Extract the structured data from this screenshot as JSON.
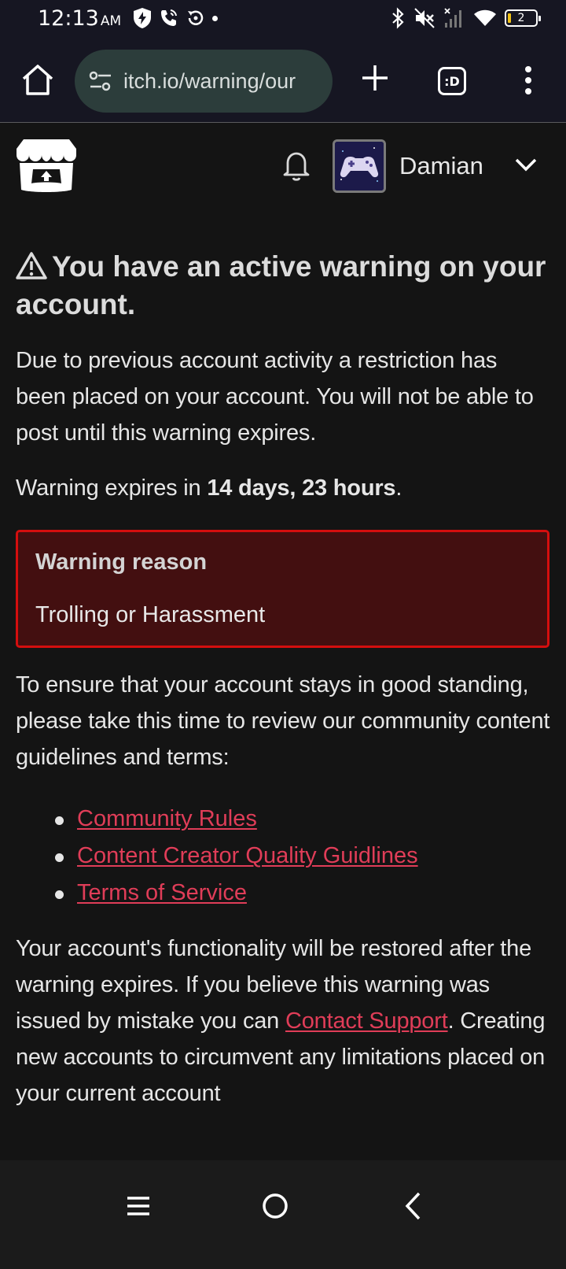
{
  "status_bar": {
    "time": "12:13",
    "ampm": "AM",
    "battery_level": "2",
    "icons_left": [
      "shield-bolt-icon",
      "wifi-call-icon",
      "sync-icon",
      "notification-dot-icon"
    ],
    "icons_right": [
      "bluetooth-icon",
      "mute-icon",
      "signal-icon",
      "wifi-icon",
      "battery-icon"
    ]
  },
  "browser": {
    "url": "itch.io/warning/our",
    "tabs_label": ":D"
  },
  "header": {
    "username": "Damian"
  },
  "warning": {
    "title": "You have an active warning on your account.",
    "intro": "Due to previous account activity a restriction has been placed on your account. You will not be able to post until this warning expires.",
    "expires_prefix": "Warning expires in ",
    "expires_value": "14 days, 23 hours",
    "expires_suffix": ".",
    "reason_title": "Warning reason",
    "reason": "Trolling or Harassment",
    "review_text": "To ensure that your account stays in good standing, please take this time to review our community content guidelines and terms:",
    "links": [
      "Community Rules",
      "Content Creator Quality Guidlines",
      "Terms of Service"
    ],
    "restore_text_1": "Your account's functionality will be restored after the warning expires. If you believe this warning was issued by mistake you can ",
    "contact_link": "Contact Support",
    "restore_text_2": ". Creating new accounts to circumvent any limitations placed on your current account"
  },
  "colors": {
    "link": "#e03d58",
    "reason_border": "#d40e0e",
    "reason_bg": "#430f10"
  }
}
